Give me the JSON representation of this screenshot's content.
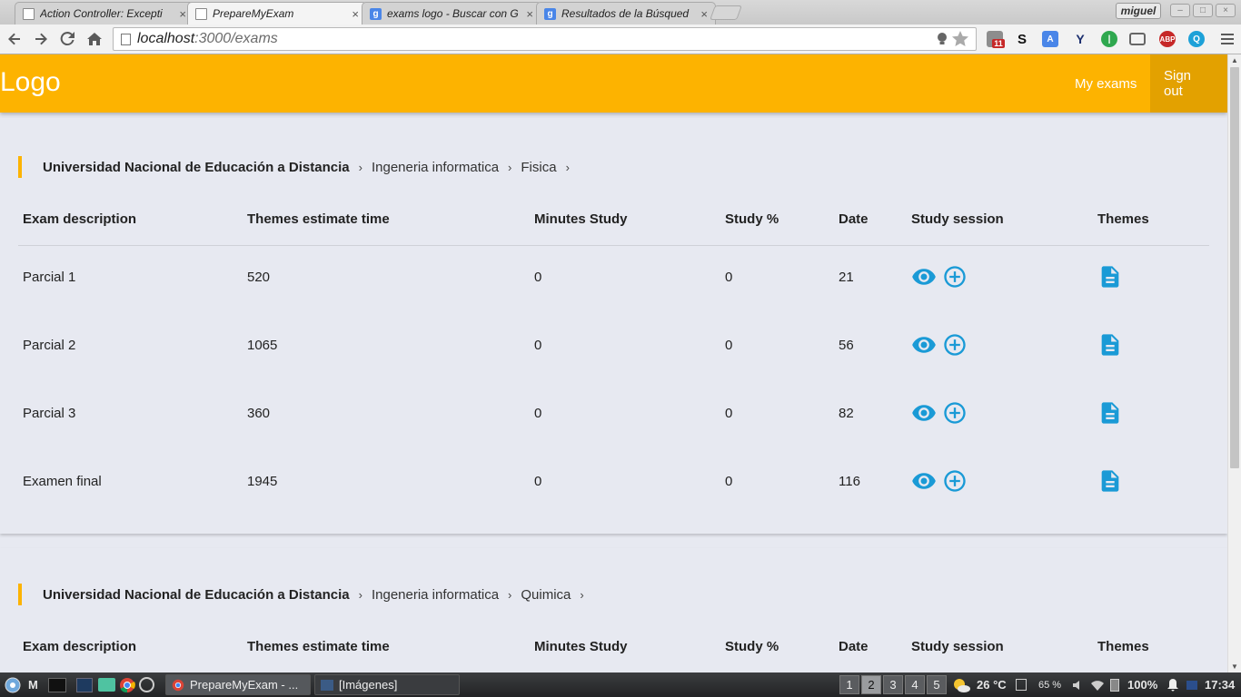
{
  "browser": {
    "tabs": [
      {
        "title": "Action Controller: Excepti",
        "favicon": "page",
        "active": false
      },
      {
        "title": "PrepareMyExam",
        "favicon": "page",
        "active": true
      },
      {
        "title": "exams logo - Buscar con G",
        "favicon": "google",
        "active": false
      },
      {
        "title": "Resultados de la Búsqued",
        "favicon": "google",
        "active": false
      }
    ],
    "tab_close_glyph": "×",
    "profile_name": "miguel",
    "url_host": "localhost",
    "url_path": ":3000/exams",
    "ext_badge": "11",
    "ext_abp_label": "ABP"
  },
  "app": {
    "logo": "Logo",
    "nav": {
      "my_exams": "My exams",
      "sign_out": "Sign out"
    },
    "accent_color": "#fdb300",
    "icon_color": "#1a9ad6"
  },
  "columns": [
    "Exam description",
    "Themes estimate time",
    "Minutes Study",
    "Study %",
    "Date",
    "Study session",
    "Themes"
  ],
  "groups": [
    {
      "breadcrumb": [
        "Universidad Nacional de Educación a Distancia",
        "Ingeneria informatica",
        "Fisica"
      ],
      "rows": [
        {
          "description": "Parcial 1",
          "estimate": "520",
          "minutes": "0",
          "percent": "0",
          "date": "21"
        },
        {
          "description": "Parcial 2",
          "estimate": "1065",
          "minutes": "0",
          "percent": "0",
          "date": "56"
        },
        {
          "description": "Parcial 3",
          "estimate": "360",
          "minutes": "0",
          "percent": "0",
          "date": "82"
        },
        {
          "description": "Examen final",
          "estimate": "1945",
          "minutes": "0",
          "percent": "0",
          "date": "116"
        }
      ]
    },
    {
      "breadcrumb": [
        "Universidad Nacional de Educación a Distancia",
        "Ingeneria informatica",
        "Quimica"
      ],
      "rows": []
    }
  ],
  "taskbar": {
    "menu_letter": "M",
    "tasks": [
      {
        "label": "PrepareMyExam - ..."
      },
      {
        "label": "[Imágenes]"
      }
    ],
    "workspaces": [
      "1",
      "2",
      "3",
      "4",
      "5"
    ],
    "active_workspace": "2",
    "weather": "26 °C",
    "cpu": "65 %",
    "battery": "100%",
    "clock": "17:34"
  }
}
